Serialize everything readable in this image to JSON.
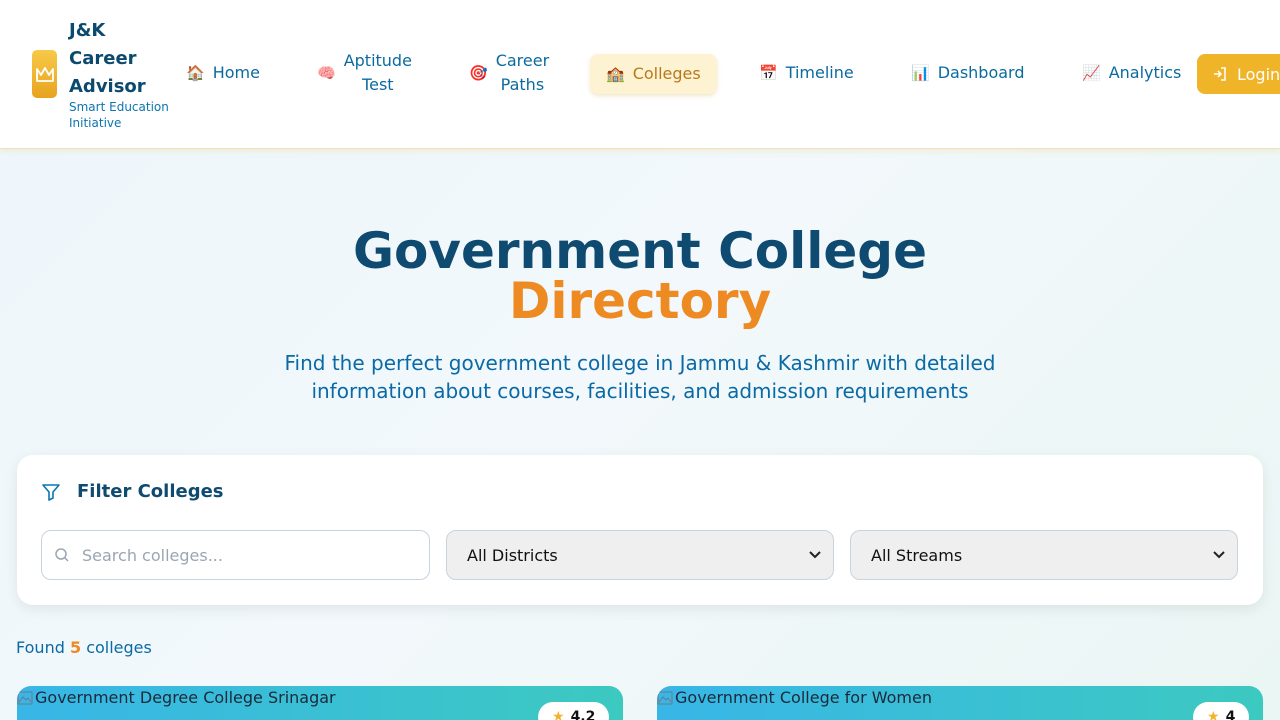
{
  "brand": {
    "title": "J&K\nCareer\nAdvisor",
    "subtitle": "Smart Education\nInitiative"
  },
  "nav": {
    "items": [
      {
        "icon": "house-emoji",
        "emoji": "🏠",
        "label": "Home"
      },
      {
        "icon": "brain-emoji",
        "emoji": "🧠",
        "label": "Aptitude\nTest"
      },
      {
        "icon": "target-emoji",
        "emoji": "🎯",
        "label": "Career\nPaths"
      },
      {
        "icon": "school-emoji",
        "emoji": "🏫",
        "label": "Colleges",
        "active": true
      },
      {
        "icon": "calendar-emoji",
        "emoji": "📅",
        "label": "Timeline"
      },
      {
        "icon": "bar-chart-emoji",
        "emoji": "📊",
        "label": "Dashboard"
      },
      {
        "icon": "trend-chart-emoji",
        "emoji": "📈",
        "label": "Analytics"
      }
    ],
    "login_label": "Login"
  },
  "hero": {
    "title_main": "Government College",
    "title_accent": "Directory",
    "subtitle": "Find the perfect government college in Jammu & Kashmir with detailed information about courses, facilities, and admission requirements"
  },
  "filter": {
    "heading": "Filter Colleges",
    "search_placeholder": "Search colleges...",
    "district_selected": "All Districts",
    "stream_selected": "All Streams"
  },
  "results": {
    "found_prefix": "Found",
    "count": "5",
    "found_suffix": "colleges"
  },
  "colleges": [
    {
      "name": "Government Degree College Srinagar",
      "rating": "4.2"
    },
    {
      "name": "Government College for Women",
      "rating": "4"
    }
  ],
  "colors": {
    "accent": "#ee8a22",
    "primary": "#0f4a70",
    "brand_gold": "#f0b429"
  }
}
